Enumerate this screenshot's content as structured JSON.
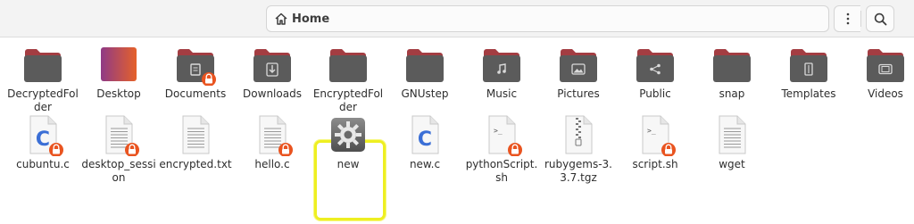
{
  "header": {
    "location": "Home",
    "home_icon": "home-icon",
    "menu_icon": "kebab-menu-icon",
    "search_icon": "search-icon"
  },
  "colors": {
    "folder_dark": "#5b5b5b",
    "folder_tab": "#a33d42",
    "folder_glyph": "#d9d9d9",
    "lock_badge": "#e95420",
    "desktop_purple": "#8f3a86",
    "desktop_orange": "#e5612a",
    "selection": "#eeef21"
  },
  "items": [
    {
      "label": "DecryptedFolder",
      "kind": "folder",
      "glyph": "none",
      "locked": false
    },
    {
      "label": "Desktop",
      "kind": "desktop",
      "glyph": "none",
      "locked": false
    },
    {
      "label": "Documents",
      "kind": "folder",
      "glyph": "document",
      "locked": true
    },
    {
      "label": "Downloads",
      "kind": "folder",
      "glyph": "download",
      "locked": false
    },
    {
      "label": "EncryptedFolder",
      "kind": "folder",
      "glyph": "none",
      "locked": false
    },
    {
      "label": "GNUstep",
      "kind": "folder",
      "glyph": "none",
      "locked": false
    },
    {
      "label": "Music",
      "kind": "folder",
      "glyph": "music",
      "locked": false
    },
    {
      "label": "Pictures",
      "kind": "folder",
      "glyph": "picture",
      "locked": false
    },
    {
      "label": "Public",
      "kind": "folder",
      "glyph": "share",
      "locked": false
    },
    {
      "label": "snap",
      "kind": "folder",
      "glyph": "none",
      "locked": false
    },
    {
      "label": "Templates",
      "kind": "folder",
      "glyph": "template",
      "locked": false
    },
    {
      "label": "Videos",
      "kind": "folder",
      "glyph": "video",
      "locked": false
    },
    {
      "label": "cubuntu.c",
      "kind": "csource",
      "glyph": "c",
      "locked": true
    },
    {
      "label": "desktop_session",
      "kind": "text",
      "glyph": "lines",
      "locked": true
    },
    {
      "label": "encrypted.txt",
      "kind": "text",
      "glyph": "lines",
      "locked": false
    },
    {
      "label": "hello.c",
      "kind": "text",
      "glyph": "lines",
      "locked": true
    },
    {
      "label": "new",
      "kind": "executable",
      "glyph": "gear",
      "locked": false,
      "selected": true
    },
    {
      "label": "new.c",
      "kind": "csource",
      "glyph": "c",
      "locked": false
    },
    {
      "label": "pythonScript.sh",
      "kind": "script",
      "glyph": "prompt",
      "locked": true
    },
    {
      "label": "rubygems-3.3.7.tgz",
      "kind": "archive",
      "glyph": "zipper",
      "locked": false
    },
    {
      "label": "script.sh",
      "kind": "script",
      "glyph": "prompt",
      "locked": true
    },
    {
      "label": "wget",
      "kind": "text",
      "glyph": "lines",
      "locked": false
    }
  ]
}
